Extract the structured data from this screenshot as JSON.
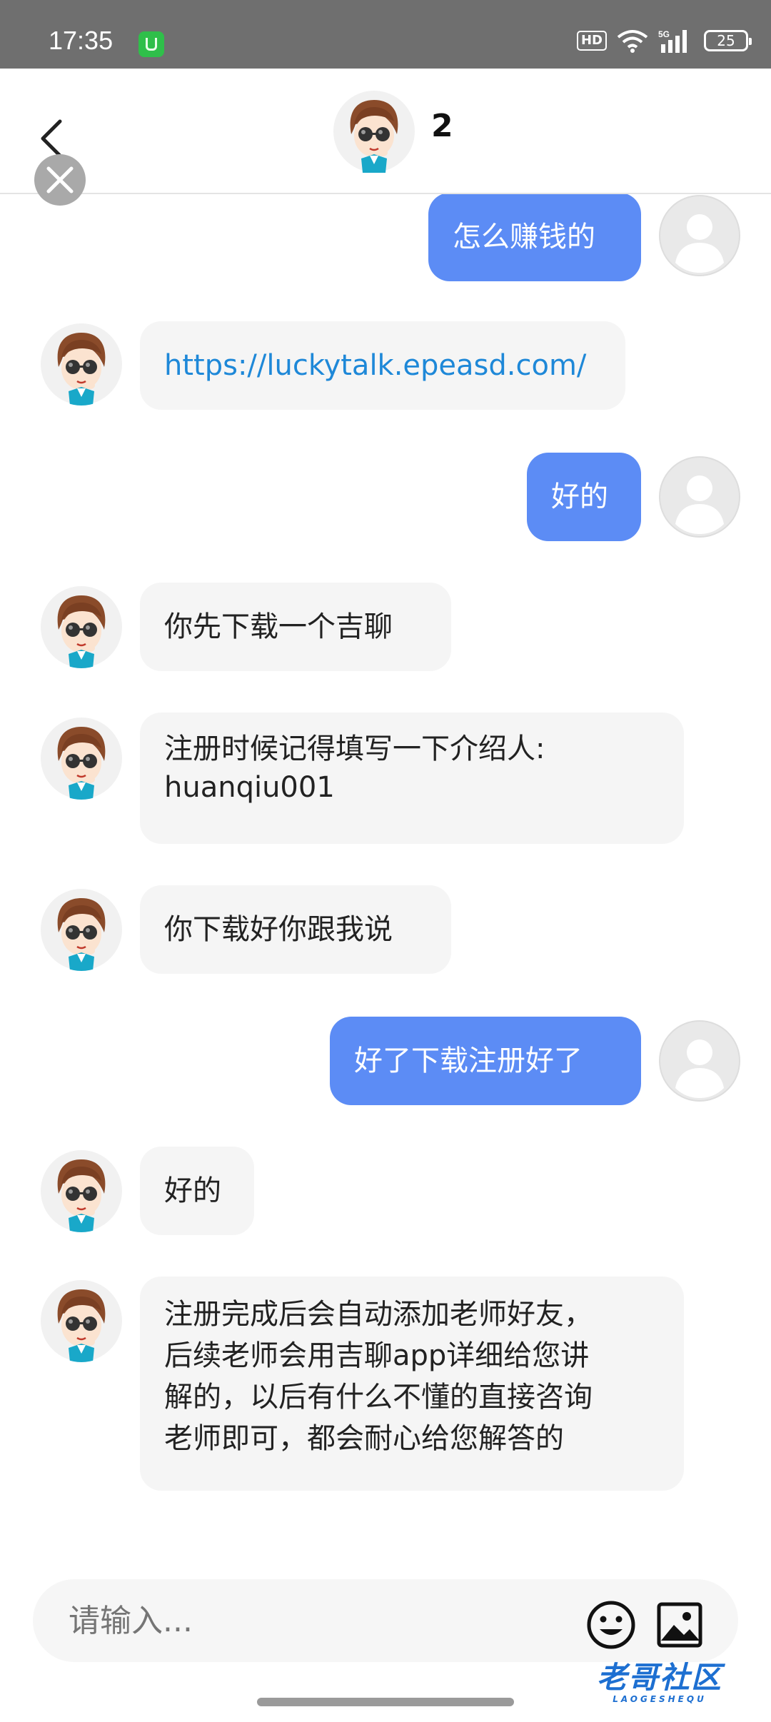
{
  "status_bar": {
    "time": "17:35",
    "hd": "HD",
    "network": "5G",
    "battery": "25"
  },
  "header": {
    "title": "2"
  },
  "messages": [
    {
      "side": "out",
      "text": "怎么赚钱的"
    },
    {
      "side": "in",
      "text": "https://luckytalk.epeasd.com/"
    },
    {
      "side": "out",
      "text": "好的"
    },
    {
      "side": "in",
      "text": "你先下载一个吉聊"
    },
    {
      "side": "in",
      "lines": [
        "注册时候记得填写一下介绍人:",
        "huanqiu001"
      ]
    },
    {
      "side": "in",
      "text": "你下载好你跟我说"
    },
    {
      "side": "out",
      "text": "好了下载注册好了"
    },
    {
      "side": "in",
      "text": "好的"
    },
    {
      "side": "in",
      "lines": [
        "注册完成后会自动添加老师好友，",
        "后续老师会用吉聊app详细给您讲",
        "解的，以后有什么不懂的直接咨询",
        "老师即可，都会耐心给您解答的"
      ]
    }
  ],
  "composer": {
    "placeholder": "请输入..."
  },
  "watermark": {
    "text": "老哥社区",
    "sub": "LAOGESHEQU"
  },
  "colors": {
    "outgoing_bubble": "#5c8cf5",
    "incoming_bubble": "#f5f5f5",
    "link": "#1e88d8"
  }
}
